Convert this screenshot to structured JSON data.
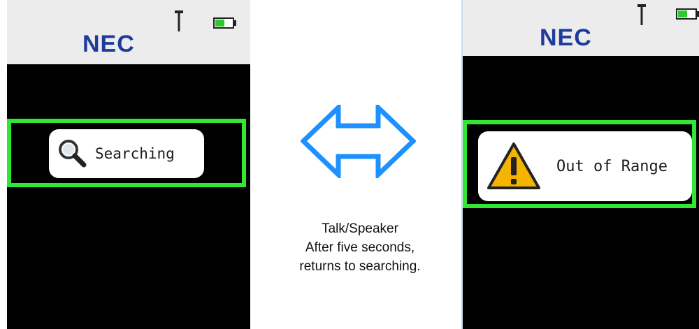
{
  "left_screen": {
    "logo": "NEC",
    "popup_text": "Searching",
    "popup_icon": "magnifier-icon"
  },
  "right_screen": {
    "logo": "NEC",
    "popup_text": "Out of Range",
    "popup_icon": "warning-icon"
  },
  "transition": {
    "arrow_icon": "double-arrow-icon",
    "caption_lines": [
      "Talk/Speaker",
      "After five seconds,",
      "returns to searching."
    ]
  },
  "colors": {
    "highlight": "#33e633",
    "arrow": "#1e90ff",
    "logo": "#1f3c9a",
    "warning": "#f5b400",
    "battery": "#2ec92e"
  }
}
